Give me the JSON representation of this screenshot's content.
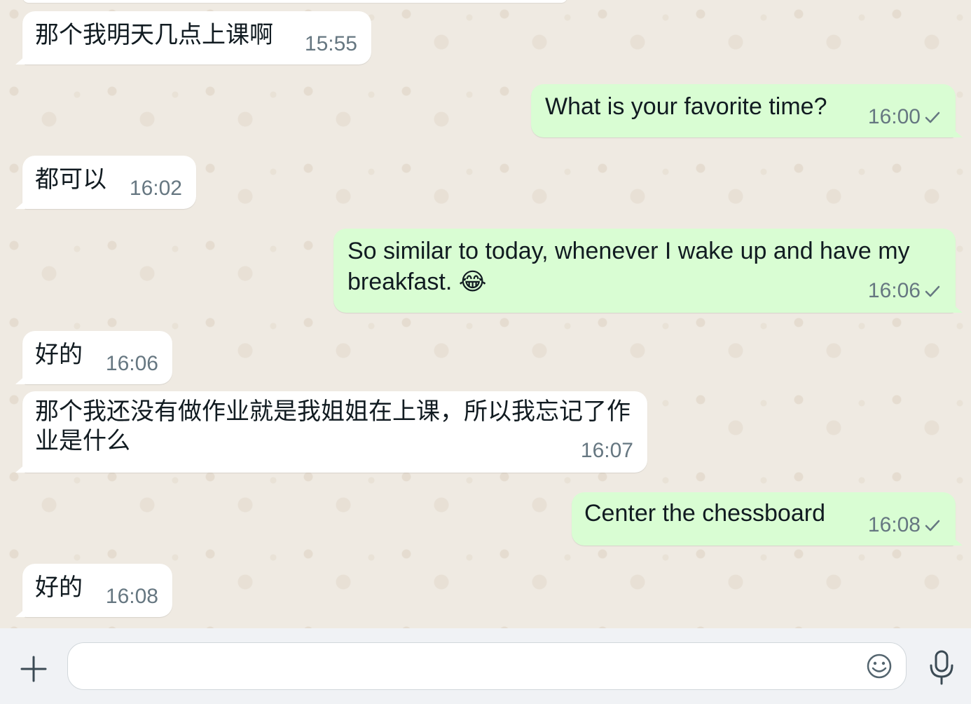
{
  "messages": [
    {
      "id": "m1",
      "direction": "incoming",
      "text": "那个我明天几点上课啊",
      "time": "15:55"
    },
    {
      "id": "m2",
      "direction": "outgoing",
      "text": "What is your favorite time?",
      "time": "16:00",
      "status": "sent"
    },
    {
      "id": "m3",
      "direction": "incoming",
      "text": "都可以",
      "time": "16:02"
    },
    {
      "id": "m4",
      "direction": "outgoing",
      "text": "So similar to today, whenever I wake up and have my breakfast. 😂",
      "time": "16:06",
      "status": "sent"
    },
    {
      "id": "m5",
      "direction": "incoming",
      "text": "好的",
      "time": "16:06"
    },
    {
      "id": "m6",
      "direction": "incoming",
      "text": "那个我还没有做作业就是我姐姐在上课，所以我忘记了作业是什么",
      "time": "16:07"
    },
    {
      "id": "m7",
      "direction": "outgoing",
      "text": "Center the chessboard",
      "time": "16:08",
      "status": "sent"
    },
    {
      "id": "m8",
      "direction": "incoming",
      "text": "好的",
      "time": "16:08"
    }
  ],
  "composer": {
    "value": "",
    "placeholder": "",
    "icons": {
      "attach": "plus-icon",
      "emoji": "emoji-icon",
      "voice": "microphone-icon"
    }
  },
  "colors": {
    "chat_background": "#efeae2",
    "incoming_bubble": "#ffffff",
    "outgoing_bubble": "#d9fdd3",
    "meta_text": "#667781",
    "composer_background": "#f0f2f5"
  }
}
